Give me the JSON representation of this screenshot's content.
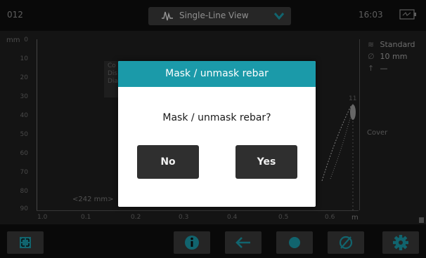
{
  "header": {
    "device_id": "012",
    "view_selector": {
      "label": "Single-Line View",
      "icon": "waveform-icon"
    },
    "time": "16:03",
    "battery_icon": "battery-charging-icon"
  },
  "plot": {
    "y_unit": "mm",
    "y_ticks": [
      "0",
      "10",
      "20",
      "30",
      "40",
      "50",
      "60",
      "70",
      "80",
      "90"
    ],
    "x_ticks": [
      "1.0",
      "0.1",
      "0.2",
      "0.3",
      "0.4",
      "0.5",
      "0.6"
    ],
    "x_unit": "m",
    "distance_label": "<242 mm>",
    "info_box_lines": [
      "Co",
      "Dis",
      "Dia"
    ],
    "peak_label": "11"
  },
  "side_panel": {
    "mode": "Standard",
    "diameter": "10 mm",
    "cover_value": "—",
    "cover_label": "Cover"
  },
  "dialog": {
    "title": "Mask / unmask rebar",
    "message": "Mask / unmask rebar?",
    "no_label": "No",
    "yes_label": "Yes"
  },
  "toolbar": {
    "buttons": [
      "fit-view-icon",
      "info-icon",
      "back-arrow-icon",
      "record-dot-icon",
      "diameter-icon",
      "settings-gear-icon"
    ]
  },
  "colors": {
    "accent": "#1b9aa9",
    "background": "#1e1e1e",
    "bar": "#0f0f0f",
    "button": "#3a3a3a",
    "icon": "#1b9aa9"
  }
}
